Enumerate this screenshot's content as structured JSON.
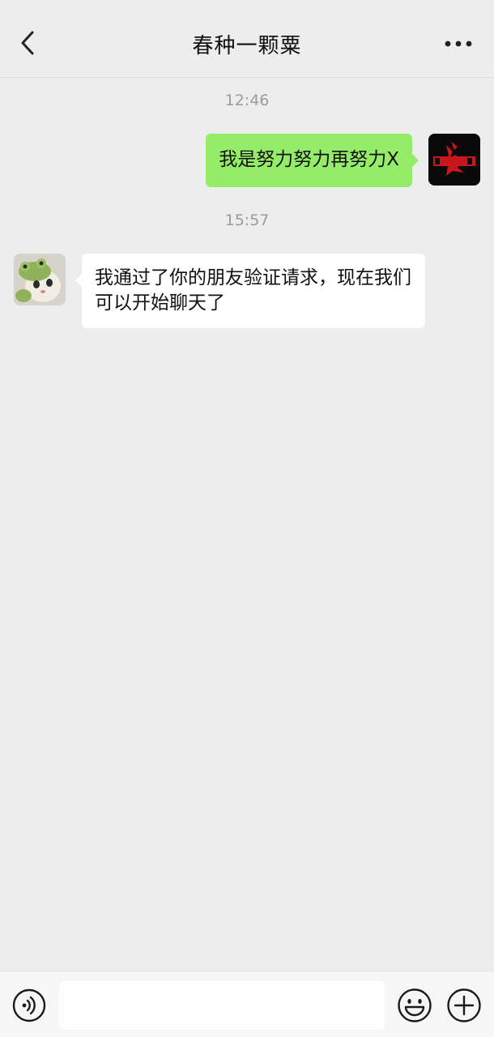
{
  "header": {
    "title": "春种一颗粟",
    "back_icon": "chevron-left-icon",
    "more_icon": "more-dots-icon"
  },
  "messages": [
    {
      "timestamp": "12:46"
    },
    {
      "sender": "me",
      "text": "我是努力努力再努力X"
    },
    {
      "timestamp": "15:57"
    },
    {
      "sender": "contact",
      "text": "我通过了你的朋友验证请求，现在我们可以开始聊天了"
    }
  ],
  "input_bar": {
    "voice_icon": "voice-icon",
    "emoji_icon": "emoji-icon",
    "plus_icon": "plus-icon",
    "text_value": ""
  },
  "colors": {
    "background": "#ededed",
    "my_bubble": "#95ec69",
    "contact_bubble": "#ffffff",
    "timestamp": "#9b9b9b"
  }
}
